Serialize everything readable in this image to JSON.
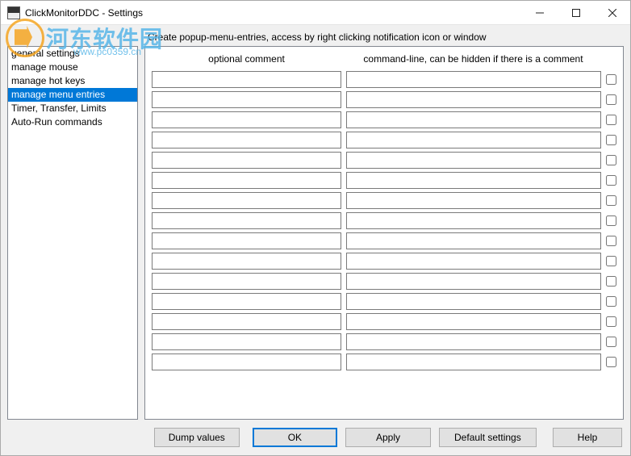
{
  "titlebar": {
    "title": "ClickMonitorDDC - Settings"
  },
  "sidebar": {
    "items": [
      {
        "label": "general settings",
        "selected": false
      },
      {
        "label": "manage mouse",
        "selected": false
      },
      {
        "label": "manage hot keys",
        "selected": false
      },
      {
        "label": "manage menu entries",
        "selected": true
      },
      {
        "label": "Timer, Transfer, Limits",
        "selected": false
      },
      {
        "label": "Auto-Run commands",
        "selected": false
      }
    ]
  },
  "content": {
    "instruction": "Create popup-menu-entries, access by right clicking notification icon or window",
    "headers": {
      "comment": "optional comment",
      "command": "command-line, can be hidden if there is a comment"
    },
    "rows": [
      {
        "comment": "",
        "command": "",
        "checked": false
      },
      {
        "comment": "",
        "command": "",
        "checked": false
      },
      {
        "comment": "",
        "command": "",
        "checked": false
      },
      {
        "comment": "",
        "command": "",
        "checked": false
      },
      {
        "comment": "",
        "command": "",
        "checked": false
      },
      {
        "comment": "",
        "command": "",
        "checked": false
      },
      {
        "comment": "",
        "command": "",
        "checked": false
      },
      {
        "comment": "",
        "command": "",
        "checked": false
      },
      {
        "comment": "",
        "command": "",
        "checked": false
      },
      {
        "comment": "",
        "command": "",
        "checked": false
      },
      {
        "comment": "",
        "command": "",
        "checked": false
      },
      {
        "comment": "",
        "command": "",
        "checked": false
      },
      {
        "comment": "",
        "command": "",
        "checked": false
      },
      {
        "comment": "",
        "command": "",
        "checked": false
      },
      {
        "comment": "",
        "command": "",
        "checked": false
      }
    ]
  },
  "buttons": {
    "dump": "Dump values",
    "ok": "OK",
    "apply": "Apply",
    "default": "Default settings",
    "help": "Help"
  },
  "watermark": {
    "text": "河东软件园",
    "sub": "www.pc0359.cn"
  }
}
